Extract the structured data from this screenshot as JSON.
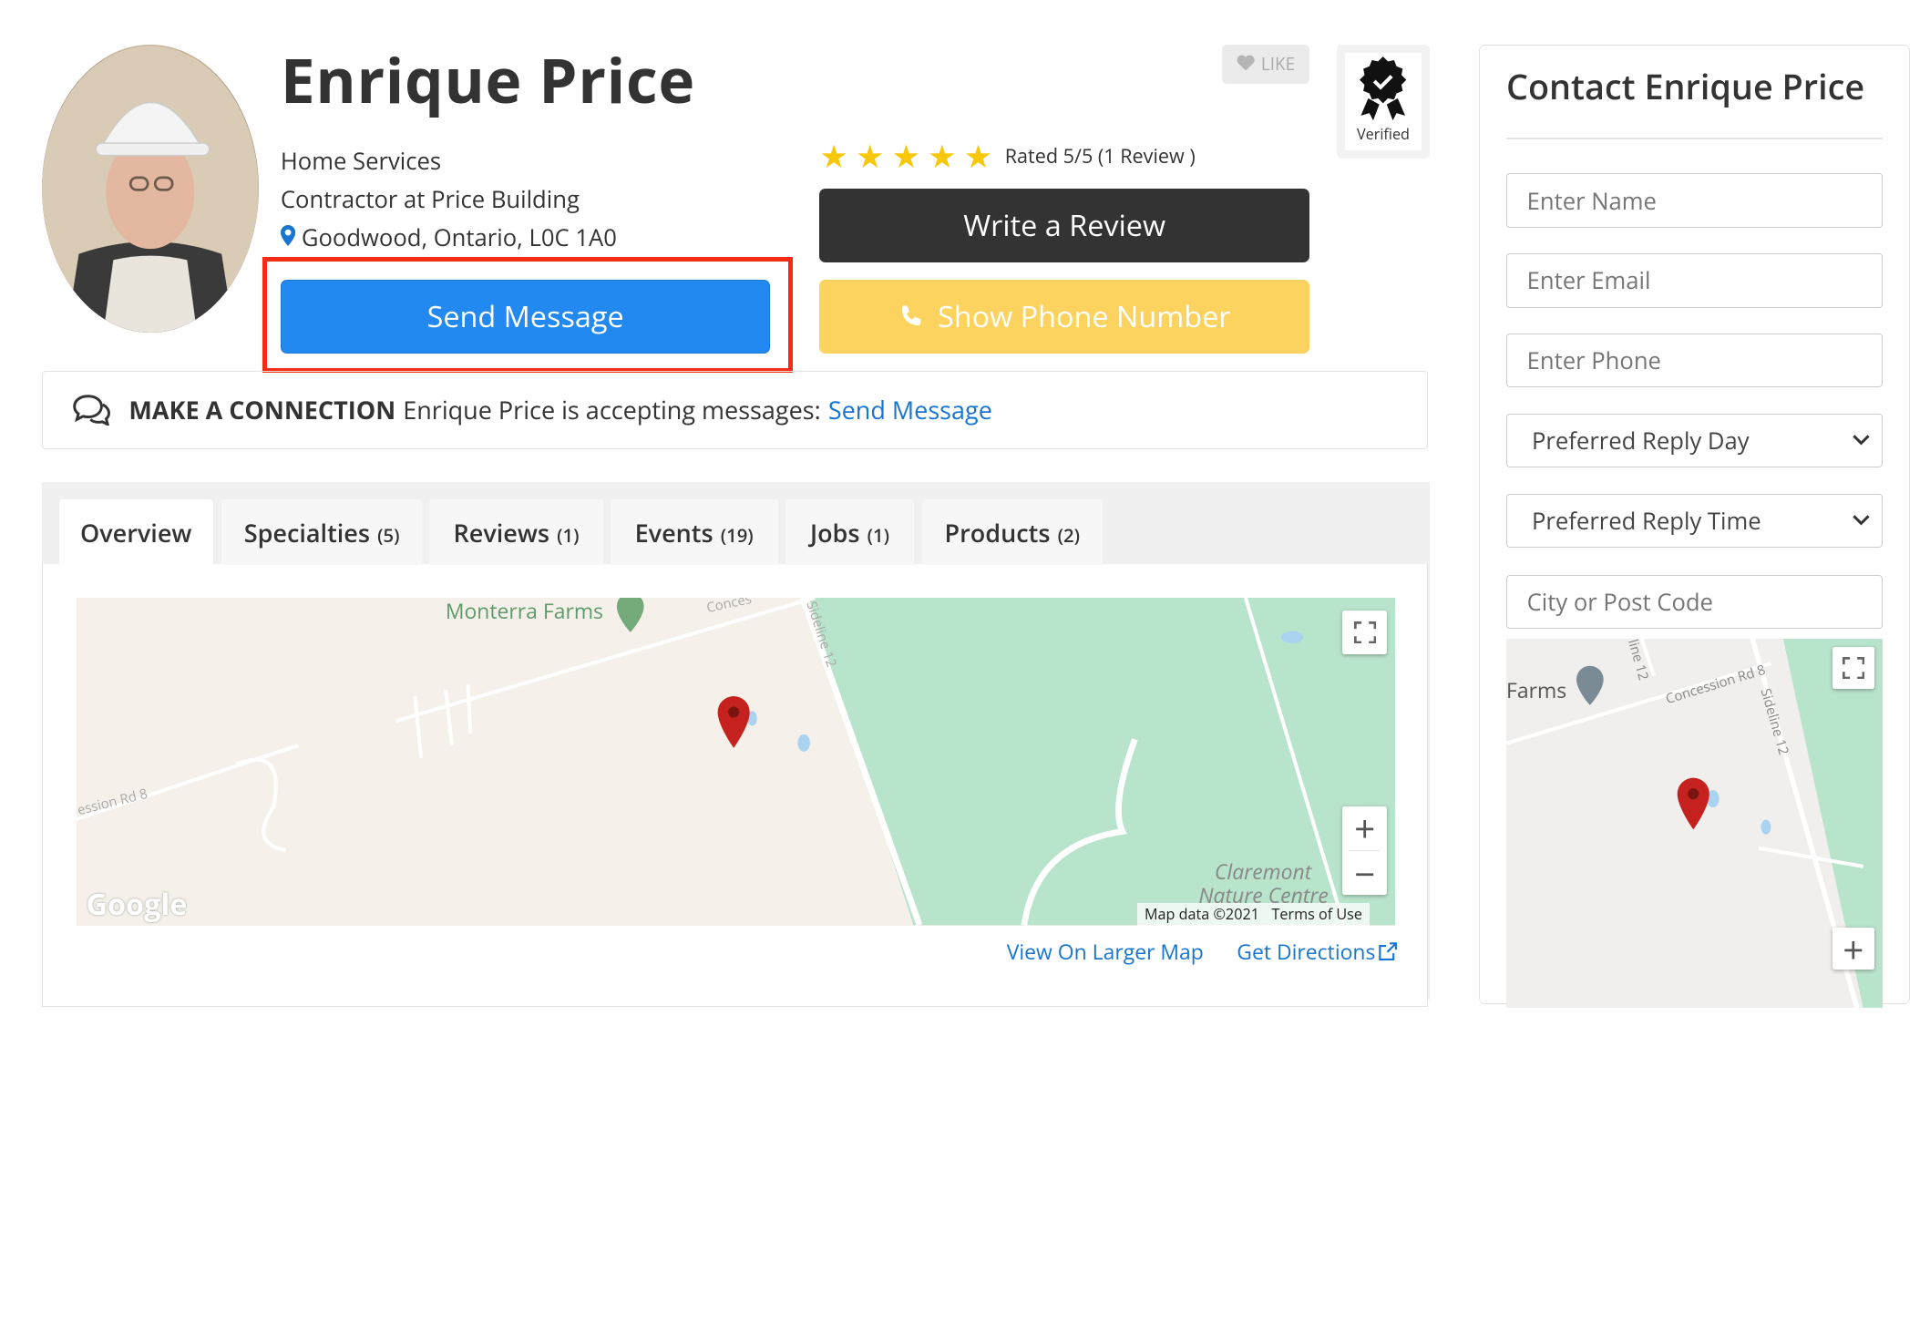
{
  "profile": {
    "name": "Enrique Price",
    "category": "Home Services",
    "title": "Contractor at Price Building",
    "location": "Goodwood, Ontario, L0C 1A0"
  },
  "rating": {
    "stars": 5,
    "text": "Rated 5/5 (1 Review )"
  },
  "buttons": {
    "send_message": "Send Message",
    "write_review": "Write a Review",
    "show_phone": "Show Phone Number",
    "like": "LIKE"
  },
  "badge": {
    "verified": "Verified"
  },
  "connection": {
    "heading": "MAKE A CONNECTION",
    "text": "Enrique Price is accepting messages:",
    "link": "Send Message"
  },
  "tabs": [
    {
      "label": "Overview",
      "count": ""
    },
    {
      "label": "Specialties",
      "count": "(5)"
    },
    {
      "label": "Reviews",
      "count": "(1)"
    },
    {
      "label": "Events",
      "count": "(19)"
    },
    {
      "label": "Jobs",
      "count": "(1)"
    },
    {
      "label": "Products",
      "count": "(2)"
    }
  ],
  "map": {
    "labels": {
      "farms": "Monterra Farms",
      "concession_top": "Conces",
      "sideline": "Sideline 12",
      "concession_left": "ession Rd 8",
      "nature_1": "Claremont",
      "nature_2": "Nature Centre",
      "google": "Google",
      "map_data": "Map data ©2021",
      "terms": "Terms of Use"
    },
    "links": {
      "larger": "View On Larger Map",
      "directions": "Get Directions"
    }
  },
  "sidebar": {
    "title": "Contact Enrique Price",
    "placeholders": {
      "name": "Enter Name",
      "email": "Enter Email",
      "phone": "Enter Phone",
      "city": "City or Post Code"
    },
    "selects": {
      "reply_day": "Preferred Reply Day",
      "reply_time": "Preferred Reply Time"
    },
    "map_labels": {
      "farms": "Farms",
      "concession": "Concession Rd 8",
      "sideline": "Sideline 12",
      "line12": "line 12"
    }
  },
  "colors": {
    "primary_blue": "#2189f0",
    "highlight_red": "#f52c14",
    "dark_button": "#333333",
    "phone_yellow": "#fdd360",
    "star_yellow": "#f7c708",
    "link_blue": "#1875d1",
    "map_green": "#b9e4cc"
  }
}
